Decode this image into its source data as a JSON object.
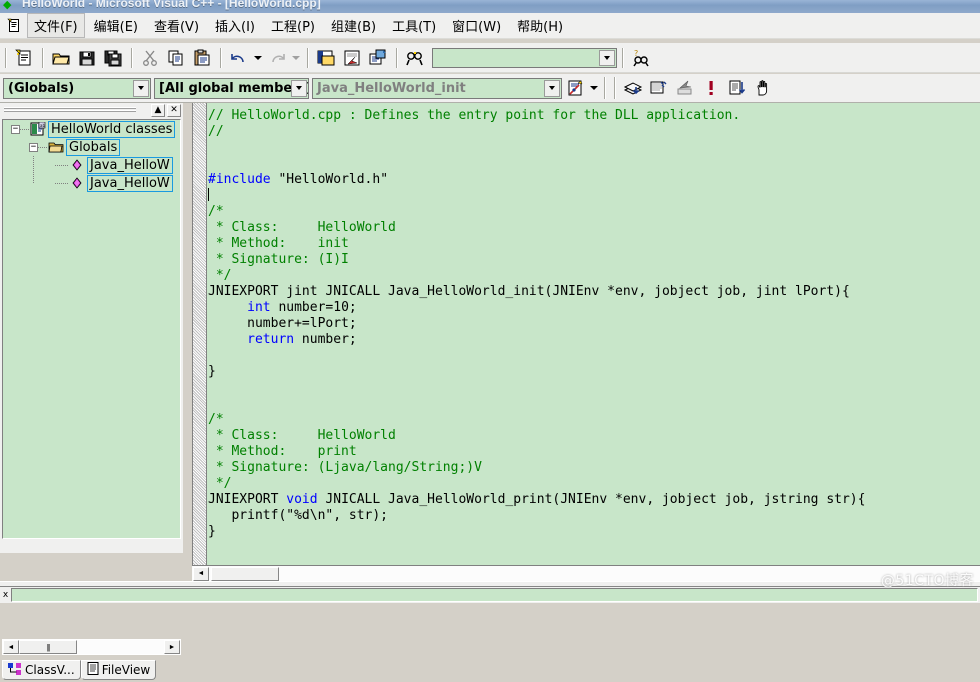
{
  "window": {
    "title": "HelloWorld - Microsoft Visual C++ - [HelloWorld.cpp]",
    "app_icon": "vcpp-icon"
  },
  "menubar": {
    "doc_icon": "document-icon",
    "items": [
      {
        "label": "文件(F)",
        "active": true
      },
      {
        "label": "编辑(E)",
        "active": false
      },
      {
        "label": "查看(V)",
        "active": false
      },
      {
        "label": "插入(I)",
        "active": false
      },
      {
        "label": "工程(P)",
        "active": false
      },
      {
        "label": "组建(B)",
        "active": false
      },
      {
        "label": "工具(T)",
        "active": false
      },
      {
        "label": "窗口(W)",
        "active": false
      },
      {
        "label": "帮助(H)",
        "active": false
      }
    ]
  },
  "toolbar": {
    "find_combo": {
      "value": "",
      "placeholder": ""
    },
    "buttons": [
      "new-document-icon",
      "open-folder-icon",
      "save-icon",
      "save-all-icon",
      "cut-icon",
      "copy-icon",
      "paste-icon",
      "undo-icon",
      "redo-icon",
      "workspace-icon",
      "output-window-icon",
      "resource-icon",
      "find-in-files-icon",
      "find-next-icon"
    ]
  },
  "wizardbar": {
    "scope_combo": "(Globals)",
    "members_combo": "[All global members]",
    "function_combo": "Java_HelloWorld_init",
    "action_icon": "wizardbar-action-icon",
    "debug_buttons": [
      "compile-icon",
      "build-icon",
      "stop-build-icon",
      "execute-icon",
      "go-icon",
      "insert-breakpoint-icon"
    ]
  },
  "workspace": {
    "caption_buttons": [
      "minimize-icon",
      "close-icon"
    ],
    "tree": [
      {
        "label": "HelloWorld classes",
        "icon": "classes-icon",
        "depth": 0,
        "expander": "-",
        "selected": true
      },
      {
        "label": "Globals",
        "icon": "folder-icon",
        "depth": 1,
        "expander": "-",
        "selected": true
      },
      {
        "label": "Java_HelloW",
        "icon": "member-icon",
        "depth": 2,
        "expander": "",
        "selected": true
      },
      {
        "label": "Java_HelloW",
        "icon": "member-icon",
        "depth": 2,
        "expander": "",
        "selected": true
      }
    ],
    "tabs": [
      {
        "label": "ClassV...",
        "icon": "classview-icon",
        "active": true
      },
      {
        "label": "FileView",
        "icon": "fileview-icon",
        "active": false
      }
    ],
    "hscroll": {
      "left_arrow": "◄",
      "right_arrow": "►",
      "thumb_grip": "|||"
    }
  },
  "editor": {
    "filename": "HelloWorld.cpp",
    "lines": [
      [
        {
          "t": "// HelloWorld.cpp : Defines the entry point for the DLL application.",
          "c": "cmt"
        }
      ],
      [
        {
          "t": "//",
          "c": "cmt"
        }
      ],
      [],
      [],
      [
        {
          "t": "#include",
          "c": "pp"
        },
        {
          "t": " \"HelloWorld.h\"",
          "c": ""
        }
      ],
      [
        {
          "t": "CARET",
          "c": "caret"
        }
      ],
      [
        {
          "t": "/*",
          "c": "cmt"
        }
      ],
      [
        {
          "t": " * Class:     HelloWorld",
          "c": "cmt"
        }
      ],
      [
        {
          "t": " * Method:    init",
          "c": "cmt"
        }
      ],
      [
        {
          "t": " * Signature: (I)I",
          "c": "cmt"
        }
      ],
      [
        {
          "t": " */",
          "c": "cmt"
        }
      ],
      [
        {
          "t": "JNIEXPORT jint JNICALL Java_HelloWorld_init(JNIEnv *env, jobject job, jint lPort){",
          "c": ""
        }
      ],
      [
        {
          "t": "     ",
          "c": ""
        },
        {
          "t": "int",
          "c": "kw"
        },
        {
          "t": " number=10;",
          "c": ""
        }
      ],
      [
        {
          "t": "     number+=lPort;",
          "c": ""
        }
      ],
      [
        {
          "t": "     ",
          "c": ""
        },
        {
          "t": "return",
          "c": "kw"
        },
        {
          "t": " number;",
          "c": ""
        }
      ],
      [],
      [
        {
          "t": "}",
          "c": ""
        }
      ],
      [],
      [],
      [
        {
          "t": "/*",
          "c": "cmt"
        }
      ],
      [
        {
          "t": " * Class:     HelloWorld",
          "c": "cmt"
        }
      ],
      [
        {
          "t": " * Method:    print",
          "c": "cmt"
        }
      ],
      [
        {
          "t": " * Signature: (Ljava/lang/String;)V",
          "c": "cmt"
        }
      ],
      [
        {
          "t": " */",
          "c": "cmt"
        }
      ],
      [
        {
          "t": "JNIEXPORT ",
          "c": ""
        },
        {
          "t": "void",
          "c": "kw"
        },
        {
          "t": " JNICALL Java_HelloWorld_print(JNIEnv *env, jobject job, jstring str){",
          "c": ""
        }
      ],
      [
        {
          "t": "   printf(\"%d\\n\", str);",
          "c": ""
        }
      ],
      [
        {
          "t": "}",
          "c": ""
        }
      ]
    ],
    "hscroll": {
      "left_arrow": "◄"
    }
  },
  "output": {
    "close_label": "x",
    "text": ""
  },
  "watermark": {
    "text": "@51CTO博客"
  },
  "colors": {
    "editor_background": "#c8e6c9",
    "comment": "#008000",
    "keyword": "#0000ff",
    "text": "#000000",
    "chrome": "#f0f0ef",
    "selection_border": "#1a9ae0"
  }
}
